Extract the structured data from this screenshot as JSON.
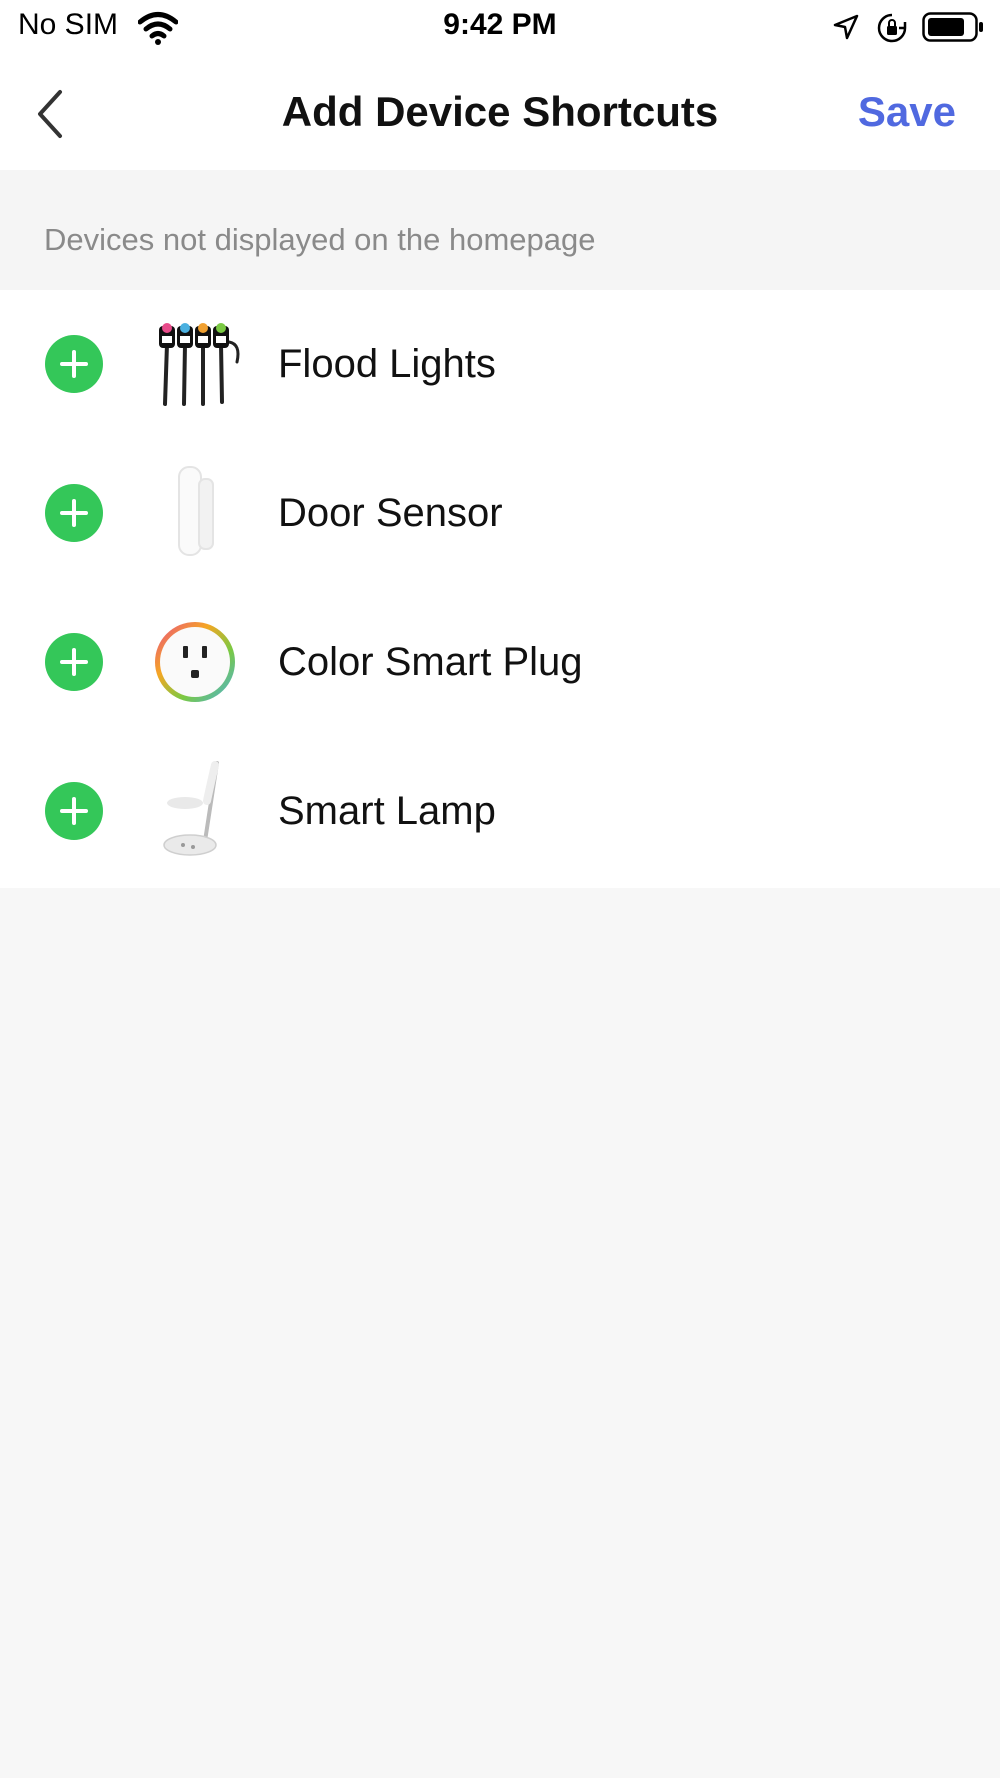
{
  "status_bar": {
    "carrier": "No SIM",
    "time": "9:42 PM",
    "icons": [
      "wifi-icon",
      "location-icon",
      "orientation-lock-icon",
      "battery-icon"
    ]
  },
  "nav": {
    "title": "Add Device Shortcuts",
    "save_label": "Save",
    "back_icon": "chevron-left-icon"
  },
  "section": {
    "header": "Devices not displayed on the homepage"
  },
  "devices": [
    {
      "name": "Flood Lights",
      "icon": "flood-lights-icon"
    },
    {
      "name": "Door Sensor",
      "icon": "door-sensor-icon"
    },
    {
      "name": "Color Smart Plug",
      "icon": "smart-plug-icon"
    },
    {
      "name": "Smart Lamp",
      "icon": "smart-lamp-icon"
    }
  ],
  "colors": {
    "accent": "#5069e0",
    "add_button": "#34c759",
    "background": "#f7f7f7"
  }
}
